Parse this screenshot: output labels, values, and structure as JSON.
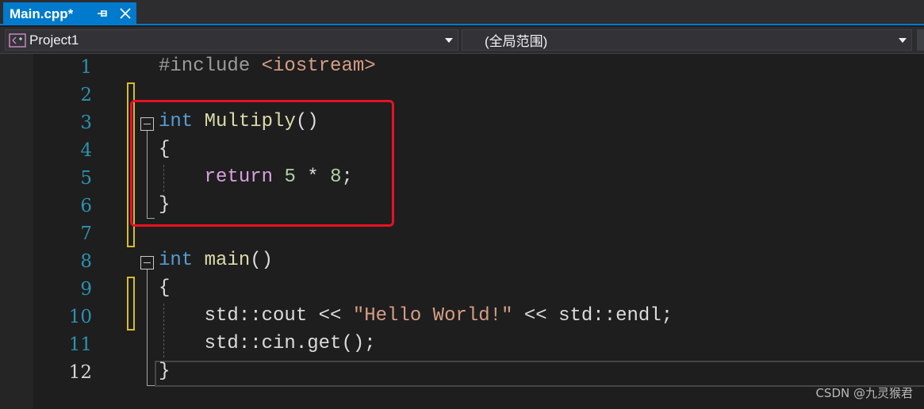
{
  "tab": {
    "title": "Main.cpp*"
  },
  "nav": {
    "project": "Project1",
    "scope": "(全局范围)"
  },
  "editor": {
    "line_numbers": [
      "1",
      "2",
      "3",
      "4",
      "5",
      "6",
      "7",
      "8",
      "9",
      "10",
      "11",
      "12"
    ],
    "active_line": "12",
    "lines": {
      "l1": {
        "directive": "#include",
        "header": "<iostream>"
      },
      "l3": {
        "type": "int",
        "name": "Multiply",
        "parens": "()"
      },
      "l4": {
        "brace": "{"
      },
      "l5": {
        "keyword": "return",
        "a": "5",
        "op": " * ",
        "b": "8",
        "semi": ";"
      },
      "l6": {
        "brace": "}"
      },
      "l8": {
        "type": "int",
        "name": "main",
        "parens": "()"
      },
      "l9": {
        "brace": "{"
      },
      "l10": {
        "ns": "std::cout",
        "op1": " << ",
        "str": "\"Hello World!\"",
        "op2": " << ",
        "end": "std::endl",
        "semi": ";"
      },
      "l11": {
        "call": "std::cin.get",
        "parens": "()",
        "semi": ";"
      },
      "l12": {
        "brace": "}"
      }
    }
  },
  "watermark": "CSDN @九灵猴君",
  "colors": {
    "keyword": "#569cd6",
    "function": "#dcdcaa",
    "control": "#d8a0df",
    "number": "#b5cea8",
    "string": "#d69d85",
    "highlight": "#e81123",
    "change_bar": "#d7ba33"
  }
}
